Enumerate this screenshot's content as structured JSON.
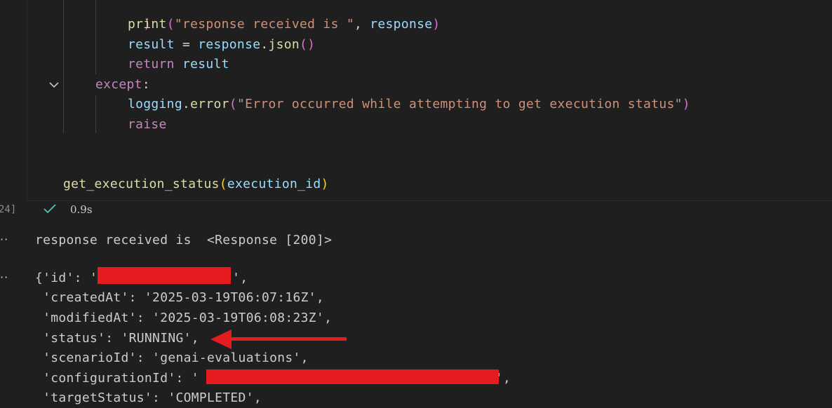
{
  "code": {
    "line_close_paren": ")",
    "print_fn": "print",
    "print_str": "\"response received is \"",
    "print_comma": ", ",
    "response_var": "response",
    "result_var": "result",
    "assign": " = ",
    "response_var2": "response",
    "json_call": ".json",
    "json_parens": "()",
    "return_kw": "return",
    "return_var": " result",
    "except_kw": "except",
    "except_colon": ":",
    "logging_var": "logging",
    "error_fn": ".error",
    "error_str": "\"Error occurred while attempting to get execution status\"",
    "raise_kw": "raise",
    "call_fn": "get_execution_status",
    "call_arg": "execution_id"
  },
  "cell": {
    "exec_count": "24]",
    "duration": "0.9s"
  },
  "output": {
    "dots": "··",
    "line1": "response received is  <Response [200]>",
    "id_prefix": "{'id': '",
    "id_suffix": "',",
    "createdAt": " 'createdAt': '2025-03-19T06:07:16Z',",
    "modifiedAt": " 'modifiedAt': '2025-03-19T06:08:23Z',",
    "status": " 'status': 'RUNNING',",
    "scenarioId": " 'scenarioId': 'genai-evaluations',",
    "configurationId_prefix": " 'configurationId': '",
    "configurationId_suffix": "',",
    "targetStatus": " 'targetStatus': 'COMPLETED',"
  },
  "colors": {
    "background": "#1f1f1f",
    "redaction": "#e51b20",
    "arrow": "#e51b20",
    "check": "#4ec9b0"
  }
}
